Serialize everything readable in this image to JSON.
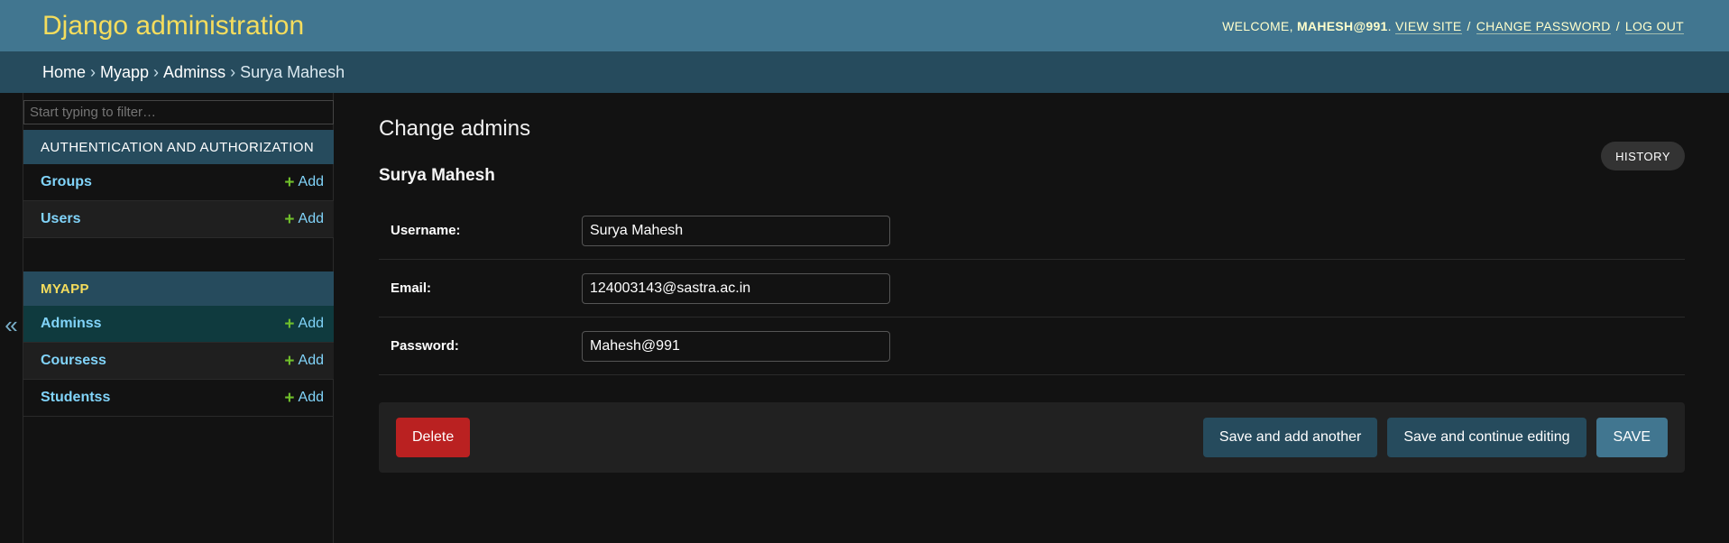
{
  "header": {
    "brand": "Django administration",
    "welcome": "WELCOME,",
    "username": "MAHESH@991",
    "view_site": "VIEW SITE",
    "change_password": "CHANGE PASSWORD",
    "log_out": "LOG OUT"
  },
  "breadcrumbs": {
    "home": "Home",
    "app": "Myapp",
    "model": "Adminss",
    "current": "Surya Mahesh",
    "separator": "›"
  },
  "sidebar": {
    "filter_placeholder": "Start typing to filter…",
    "toggle": "«",
    "modules": [
      {
        "caption": "AUTHENTICATION AND AUTHORIZATION",
        "items": [
          {
            "label": "Groups",
            "add": "Add"
          },
          {
            "label": "Users",
            "add": "Add"
          }
        ]
      },
      {
        "caption": "MYAPP",
        "items": [
          {
            "label": "Adminss",
            "add": "Add"
          },
          {
            "label": "Coursess",
            "add": "Add"
          },
          {
            "label": "Studentss",
            "add": "Add"
          }
        ]
      }
    ]
  },
  "content": {
    "title": "Change admins",
    "history": "HISTORY",
    "object_name": "Surya Mahesh",
    "fields": [
      {
        "label": "Username:",
        "value": "Surya Mahesh"
      },
      {
        "label": "Email:",
        "value": "124003143@sastra.ac.in"
      },
      {
        "label": "Password:",
        "value": "Mahesh@991"
      }
    ],
    "buttons": {
      "delete": "Delete",
      "save_add_another": "Save and add another",
      "save_continue": "Save and continue editing",
      "save": "SAVE"
    }
  },
  "colors": {
    "header_bg": "#417690",
    "breadcrumb_bg": "#264b5d",
    "brand": "#f5dd5d",
    "link": "#81d4fa",
    "add_plus": "#70bf2b",
    "delete": "#ba2121"
  },
  "icons": {
    "add": "plus-icon",
    "toggle": "double-chevron-left-icon"
  }
}
